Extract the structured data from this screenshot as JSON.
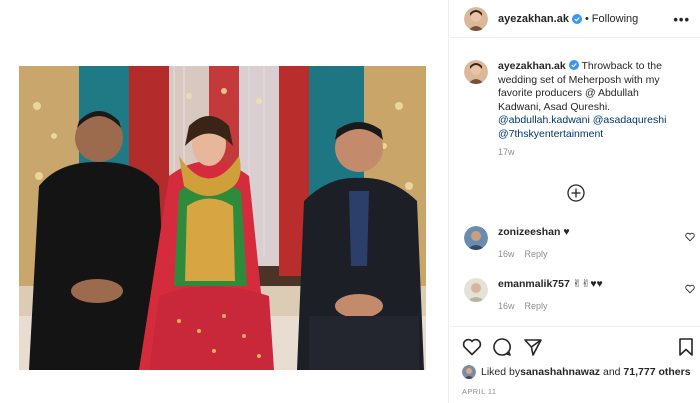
{
  "post": {
    "photo_label": "wedding-set-photo"
  },
  "header": {
    "username": "ayezakhan.ak",
    "separator": "•",
    "follow_state": "Following",
    "more_label": "•••"
  },
  "caption": {
    "username": "ayezakhan.ak",
    "text_part1": " Throwback to the wedding set of Meherposh with my favorite producers @ Abdullah Kadwani, Asad Qureshi. ",
    "mention1": "@abdullah.kadwani",
    "mention2": "@asadaqureshi",
    "mention3": "@7thskyentertainment",
    "time": "17w"
  },
  "comments": [
    {
      "username": "zonizeeshan",
      "text": " ♥",
      "time": "16w",
      "reply": "Reply"
    },
    {
      "username": "emanmalik757",
      "text": " ✌✌♥♥",
      "time": "16w",
      "reply": "Reply"
    }
  ],
  "likes": {
    "prefix": "Liked by ",
    "user": "sanashahnawaz",
    "middle": " and ",
    "count": "71,777 others"
  },
  "date": "APRIL 11",
  "colors": {
    "link": "#00376b",
    "verified": "#3897f0",
    "muted": "#8e8e8e"
  }
}
